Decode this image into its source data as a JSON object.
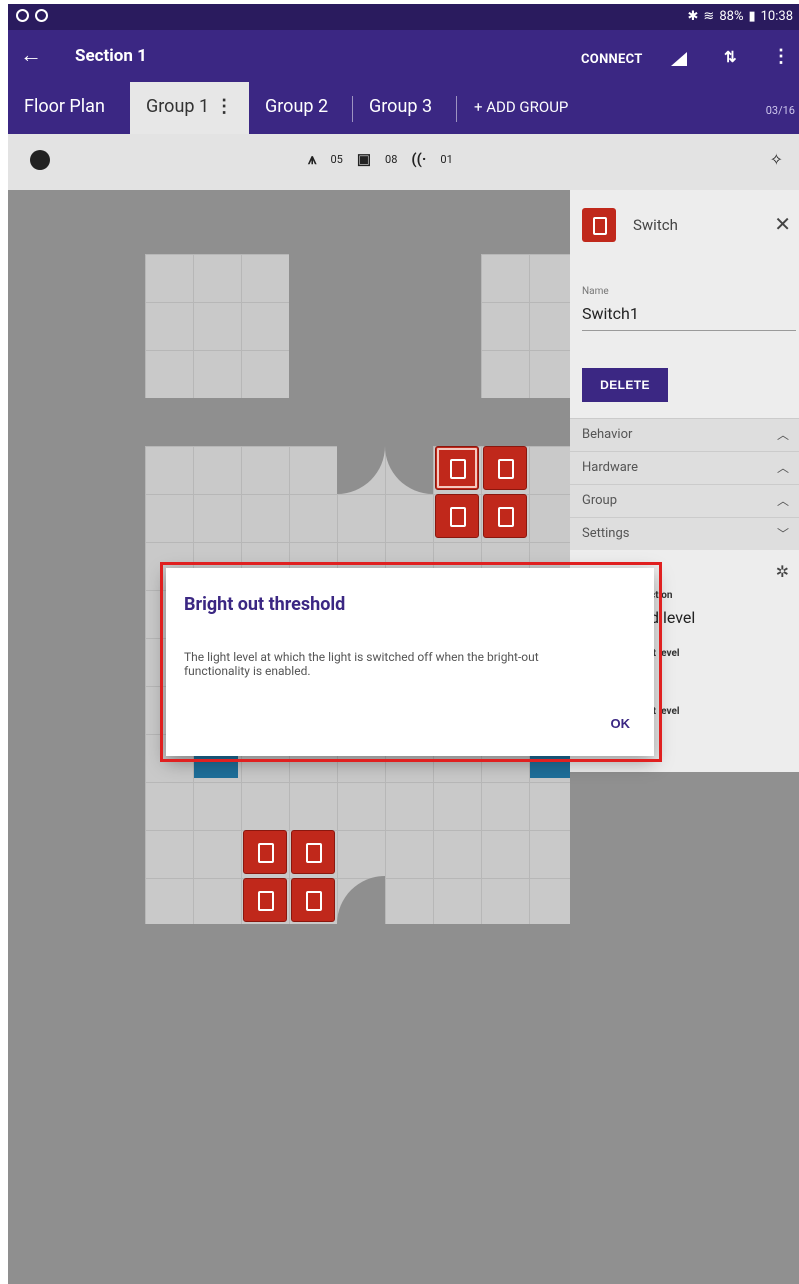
{
  "statusbar": {
    "left_icons": [
      "sync-icon",
      "sync-icon"
    ],
    "battery": "88%",
    "time": "10:38"
  },
  "appbar": {
    "back_icon": "back-arrow-icon",
    "title": "Section 1",
    "connect_label": "CONNECT",
    "signal_icon": "signal-icon",
    "sort_icon": "sort-icon",
    "more_icon": "more-vert-icon"
  },
  "tabs": {
    "items": [
      {
        "label": "Floor Plan",
        "active": false
      },
      {
        "label": "Group 1",
        "active": true
      },
      {
        "label": "Group 2",
        "active": false
      },
      {
        "label": "Group 3",
        "active": false
      }
    ],
    "add_group_label": "+ ADD GROUP",
    "page_count": "03/16"
  },
  "toolbar": {
    "counts": [
      {
        "icon": "luminaire-icon",
        "value": "05"
      },
      {
        "icon": "switch-icon",
        "value": "08"
      },
      {
        "icon": "sensor-icon",
        "value": "01"
      }
    ]
  },
  "panel": {
    "device_type": "Switch",
    "name_label": "Name",
    "name_value": "Switch1",
    "delete_label": "DELETE",
    "sections": [
      {
        "label": "Behavior",
        "state": "expanded"
      },
      {
        "label": "Hardware",
        "state": "expanded"
      },
      {
        "label": "Group",
        "state": "expanded"
      },
      {
        "label": "Settings",
        "state": "collapsed"
      }
    ],
    "settings_fragments": {
      "line1": "ction",
      "line2": "d level",
      "line3": "it level",
      "line4": "it level"
    }
  },
  "dialog": {
    "title": "Bright out threshold",
    "body": "The light level at which the light is switched off when the bright-out functionality is enabled.",
    "ok_label": "OK"
  },
  "colors": {
    "primary": "#3b2783",
    "status_bar": "#2a1b5e",
    "device_red": "#c0281b",
    "sensor_blue": "#1e6f9a",
    "highlight": "#e02020"
  }
}
